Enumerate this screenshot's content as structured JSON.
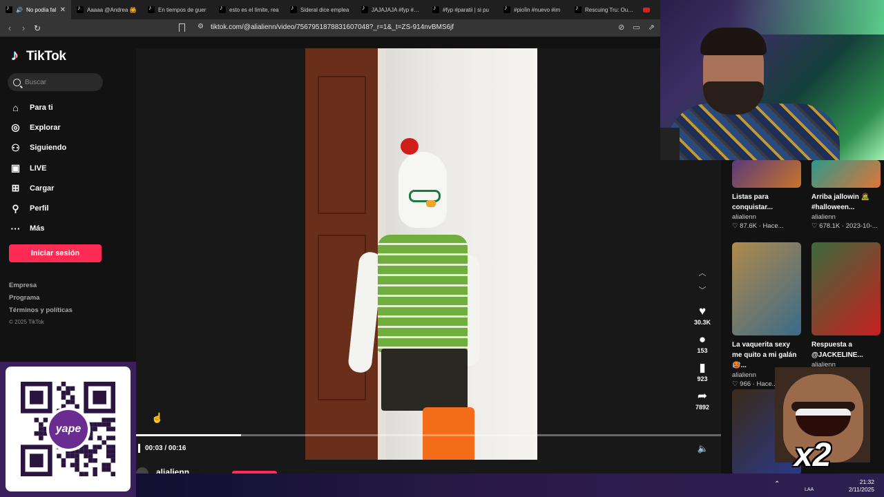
{
  "browser": {
    "tabs": [
      {
        "label": "No podía fal",
        "active": true
      },
      {
        "label": "Aaaaa @Andrea 🙆"
      },
      {
        "label": "En tiempos de guer"
      },
      {
        "label": "esto es el límite, rea"
      },
      {
        "label": "Sideral dice emplea"
      },
      {
        "label": "JAJAJAJA #fyp #par"
      },
      {
        "label": "#fyp #paratii | si pu"
      },
      {
        "label": "#pioÍin #nuevo #im"
      },
      {
        "label": "Rescuing Tru: Our N"
      }
    ],
    "url": "tiktok.com/@alialienn/video/7567951878831607048?_r=1&_t=ZS-914nvBMS6jf"
  },
  "sidebar": {
    "logo": "TikTok",
    "search_placeholder": "Buscar",
    "nav": [
      {
        "label": "Para ti",
        "icon": "home-icon",
        "glyph": "⌂"
      },
      {
        "label": "Explorar",
        "icon": "compass-icon",
        "glyph": "◎"
      },
      {
        "label": "Siguiendo",
        "icon": "following-icon",
        "glyph": "⚇"
      },
      {
        "label": "LIVE",
        "icon": "live-icon",
        "glyph": "▣"
      },
      {
        "label": "Cargar",
        "icon": "upload-icon",
        "glyph": "⊞"
      },
      {
        "label": "Perfil",
        "icon": "profile-icon",
        "glyph": "⚲"
      },
      {
        "label": "Más",
        "icon": "more-icon",
        "glyph": "···"
      }
    ],
    "login_button": "Iniciar sesión",
    "footer": [
      "Empresa",
      "Programa",
      "Términos y políticas"
    ],
    "copyright": "© 2025 TikTok"
  },
  "player": {
    "time": "00:03 / 00:16",
    "progress": 0.18,
    "author": "alialienn",
    "actions": [
      {
        "icon": "heart-icon",
        "glyph": "♥",
        "count": "30.3K"
      },
      {
        "icon": "comment-icon",
        "glyph": "●",
        "count": "153"
      },
      {
        "icon": "bookmark-icon",
        "glyph": "▮",
        "count": "923"
      },
      {
        "icon": "share-icon",
        "glyph": "➦",
        "count": "7892"
      }
    ]
  },
  "recommendations": [
    {
      "title": "Listas para conquistar...",
      "user": "alialienn",
      "likes": "87.6K",
      "date": "Hace...",
      "colors": [
        "#5a3a7a",
        "#c8742a"
      ]
    },
    {
      "title": "Arriba jallowin 🧟 #halloween...",
      "user": "alialienn",
      "likes": "678.1K",
      "date": "2023-10-...",
      "colors": [
        "#2a9a8a",
        "#e0743a"
      ]
    },
    {
      "title": "La vaquerita sexy me quito a mi galán🥵...",
      "user": "alialienn",
      "likes": "966",
      "date": "Hace...",
      "colors": [
        "#b08a4a",
        "#3a6a8a"
      ]
    },
    {
      "title": "Respuesta a @JACKELINE...",
      "user": "alialienn",
      "likes": "",
      "date": "",
      "colors": [
        "#3a6a3a",
        "#c82020"
      ]
    }
  ],
  "qr": {
    "brand": "yape"
  },
  "meme": {
    "badge": "x2"
  },
  "taskbar": {
    "lang": "LAA",
    "time": "21:32",
    "date": "2/11/2025"
  }
}
